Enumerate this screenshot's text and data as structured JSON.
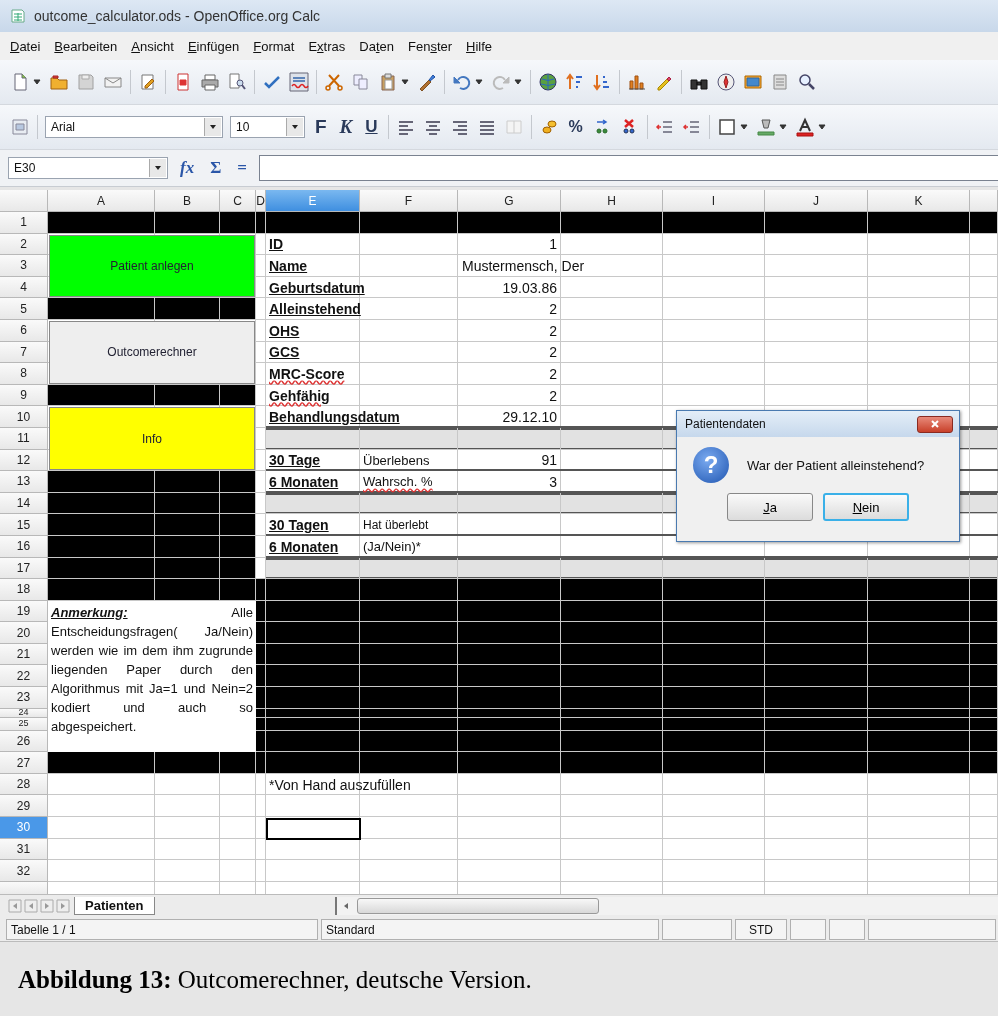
{
  "window": {
    "title": "outcome_calculator.ods - OpenOffice.org Calc"
  },
  "menu": [
    {
      "key": "D",
      "after": "atei"
    },
    {
      "key": "B",
      "after": "earbeiten"
    },
    {
      "key": "A",
      "after": "nsicht"
    },
    {
      "key": "E",
      "after": "infügen"
    },
    {
      "key": "F",
      "after": "ormat"
    },
    {
      "before": "E",
      "key": "x",
      "after": "tras"
    },
    {
      "before": "Da",
      "key": "t",
      "after": "en"
    },
    {
      "before": "Fen",
      "key": "s",
      "after": "ter"
    },
    {
      "key": "H",
      "after": "ilfe"
    }
  ],
  "font_toolbar": {
    "font": "Arial",
    "size": "10",
    "style_buttons": [
      "F",
      "K",
      "U"
    ],
    "percent": "%"
  },
  "formula_bar": {
    "cell": "E30",
    "buttons": [
      "fx",
      "Σ",
      "="
    ]
  },
  "sheet": {
    "columns": [
      {
        "label": "A",
        "selected": false
      },
      {
        "label": "B",
        "selected": false
      },
      {
        "label": "C",
        "selected": false
      },
      {
        "label": "D",
        "selected": false
      },
      {
        "label": "E",
        "selected": true
      },
      {
        "label": "F",
        "selected": false
      },
      {
        "label": "G",
        "selected": false
      },
      {
        "label": "H",
        "selected": false
      },
      {
        "label": "I",
        "selected": false
      },
      {
        "label": "J",
        "selected": false
      },
      {
        "label": "K",
        "selected": false
      }
    ],
    "rows": [
      {
        "label": "1",
        "selected": false
      },
      {
        "label": "2",
        "selected": false
      },
      {
        "label": "3",
        "selected": false
      },
      {
        "label": "4",
        "selected": false
      },
      {
        "label": "5",
        "selected": false
      },
      {
        "label": "6",
        "selected": false
      },
      {
        "label": "7",
        "selected": false
      },
      {
        "label": "8",
        "selected": false
      },
      {
        "label": "9",
        "selected": false
      },
      {
        "label": "10",
        "selected": false
      },
      {
        "label": "11",
        "selected": false
      },
      {
        "label": "12",
        "selected": false
      },
      {
        "label": "13",
        "selected": false
      },
      {
        "label": "14",
        "selected": false
      },
      {
        "label": "15",
        "selected": false
      },
      {
        "label": "16",
        "selected": false
      },
      {
        "label": "17",
        "selected": false
      },
      {
        "label": "18",
        "selected": false
      },
      {
        "label": "19",
        "selected": false
      },
      {
        "label": "20",
        "selected": false
      },
      {
        "label": "21",
        "selected": false
      },
      {
        "label": "22",
        "selected": false
      },
      {
        "label": "23",
        "selected": false
      },
      {
        "label": "24",
        "selected": false
      },
      {
        "label": "25",
        "selected": false
      },
      {
        "label": "26",
        "selected": false
      },
      {
        "label": "27",
        "selected": false
      },
      {
        "label": "28",
        "selected": false
      },
      {
        "label": "29",
        "selected": false
      },
      {
        "label": "30",
        "selected": true
      },
      {
        "label": "31",
        "selected": false
      },
      {
        "label": "32",
        "selected": false
      }
    ],
    "buttons": [
      {
        "label": "Patient anlegen",
        "color": "#00ff00"
      },
      {
        "label": "Outcomerechner",
        "color": "#eeeeee"
      },
      {
        "label": "Info",
        "color": "#ffff00"
      }
    ],
    "fields": [
      {
        "label": "ID",
        "value": "1",
        "kind": "number",
        "misspelled": false
      },
      {
        "label": "Name",
        "value": "Mustermensch, Der",
        "kind": "text",
        "misspelled": false
      },
      {
        "label": "Geburtsdatum",
        "value": "19.03.86",
        "kind": "number",
        "misspelled": false
      },
      {
        "label": "Alleinstehend",
        "value": "2",
        "kind": "number",
        "misspelled": false
      },
      {
        "label": "OHS",
        "value": "2",
        "kind": "number",
        "misspelled": false
      },
      {
        "label": "GCS",
        "value": "2",
        "kind": "number",
        "misspelled": false
      },
      {
        "label": "MRC-Score",
        "value": "2",
        "kind": "number",
        "misspelled": true
      },
      {
        "label": "Gehfähig",
        "value": "2",
        "kind": "number",
        "misspelled": true
      },
      {
        "label": "Behandlungsdatum",
        "value": "29.12.10",
        "kind": "number",
        "misspelled": false
      }
    ],
    "results": [
      {
        "label": "30 Tage",
        "sublabel": "Überlebens",
        "value": "91",
        "misspelled": false
      },
      {
        "label": "6 Monaten",
        "sublabel": "Wahrsch. %",
        "value": "3",
        "misspelled": true
      },
      {
        "label": "30 Tagen",
        "sublabel": "Hat überlebt",
        "misspelled": false
      },
      {
        "label": "6 Monaten",
        "sublabel": "(Ja/Nein)*",
        "misspelled": false
      }
    ],
    "note": "**Anmerkung:** Alle Entscheidungsfragen( Ja/Nein) werden wie im dem ihm zugrunde liegenden Paper durch den Algorithmus mit Ja=1 und Nein=2 kodiert und auch so abgespeichert.",
    "footnote": "*Von Hand auszufüllen"
  },
  "dialog": {
    "title": "Patientendaten",
    "icon": "?",
    "message": "War der Patient alleinstehend?",
    "buttons": [
      {
        "key": "J",
        "after": "a",
        "selected": false
      },
      {
        "key": "N",
        "after": "ein",
        "selected": true
      }
    ]
  },
  "sheet_tabs": [
    {
      "label": "Patienten",
      "selected": true
    }
  ],
  "status_bar": [
    "Tabelle 1 / 1",
    "Standard",
    "STD"
  ],
  "caption": "**Abbildung 13:** Outcomerechner, deutsche Version."
}
